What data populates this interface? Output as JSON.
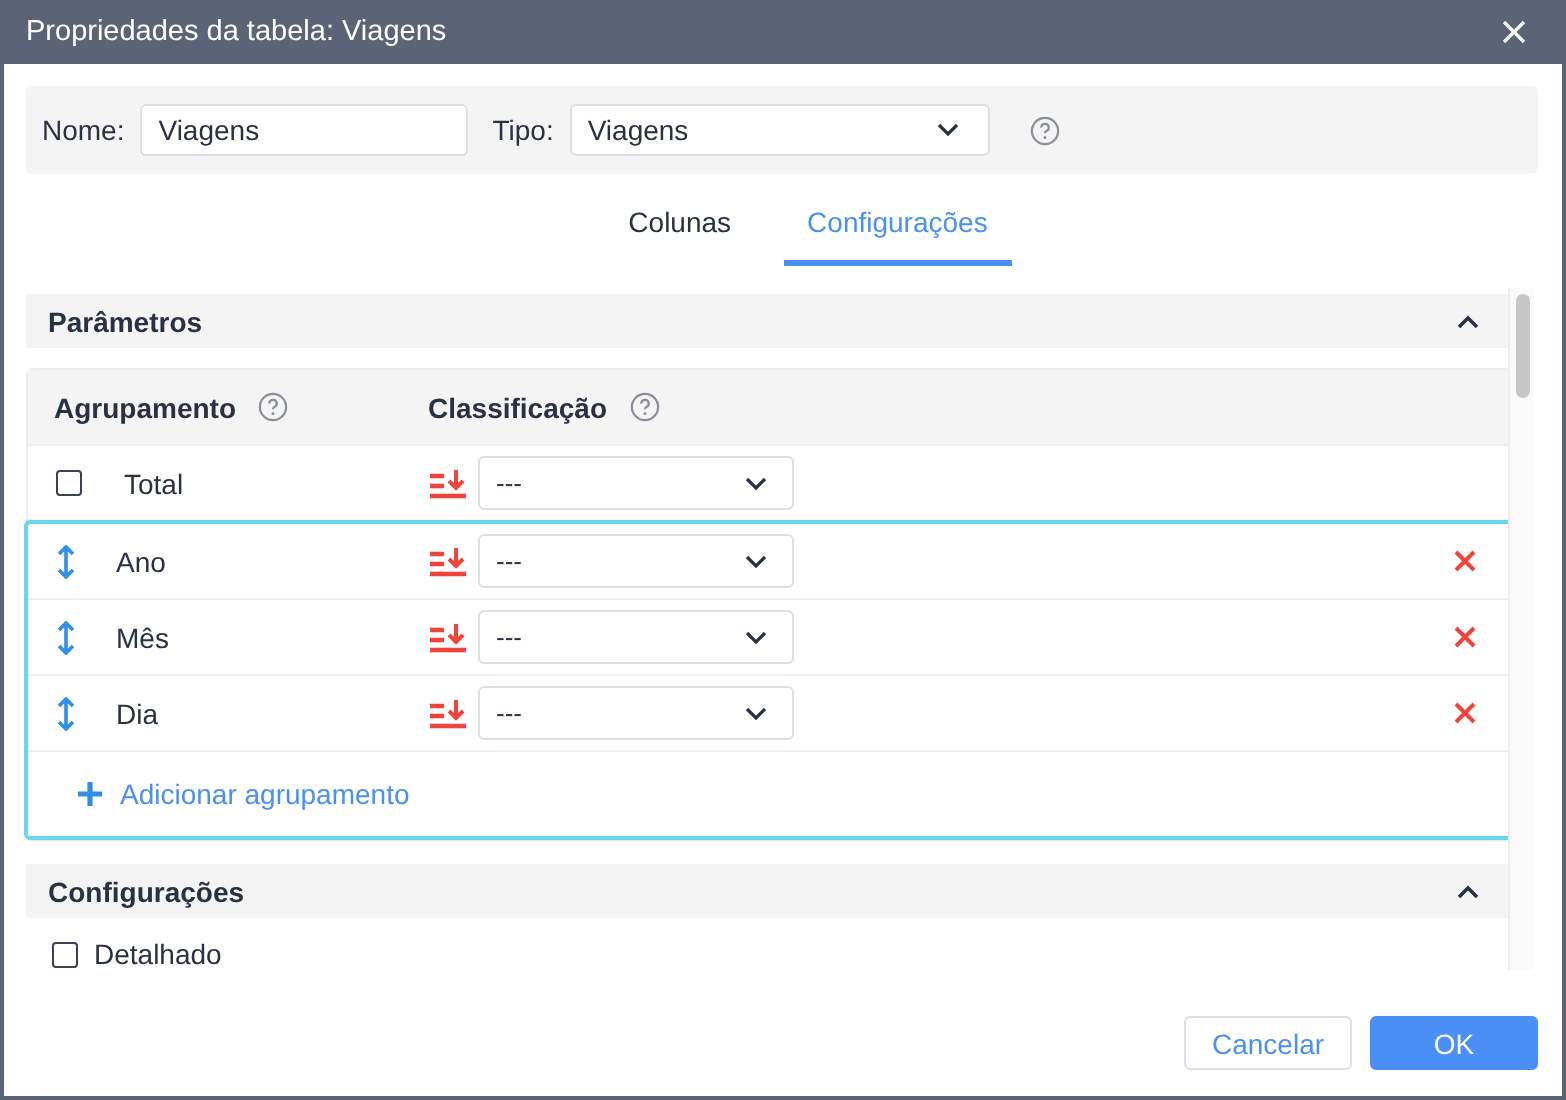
{
  "window": {
    "title": "Propriedades da tabela: Viagens"
  },
  "fields": [
    {
      "kind": "text",
      "label": "Nome:",
      "value": "Viagens"
    },
    {
      "kind": "select",
      "label": "Tipo:",
      "value": "Viagens"
    }
  ],
  "tabs": [
    {
      "label": "Colunas",
      "selected": false
    },
    {
      "label": "Configurações",
      "selected": true
    }
  ],
  "parameters": {
    "title": "Parâmetros",
    "expanded": true,
    "columns": [
      "Agrupamento",
      "Classificação"
    ],
    "total": {
      "label": "Total",
      "checked": false,
      "sort": "---"
    },
    "groups": [
      {
        "label": "Ano",
        "sort": "---"
      },
      {
        "label": "Mês",
        "sort": "---"
      },
      {
        "label": "Dia",
        "sort": "---"
      }
    ],
    "add": "Adicionar agrupamento"
  },
  "settings": {
    "title": "Configurações",
    "expanded": true,
    "options": [
      {
        "label": "Detalhado",
        "checked": false
      }
    ]
  },
  "buttons": [
    {
      "label": "Cancelar",
      "kind": "secondary"
    },
    {
      "label": "OK",
      "kind": "primary"
    }
  ]
}
